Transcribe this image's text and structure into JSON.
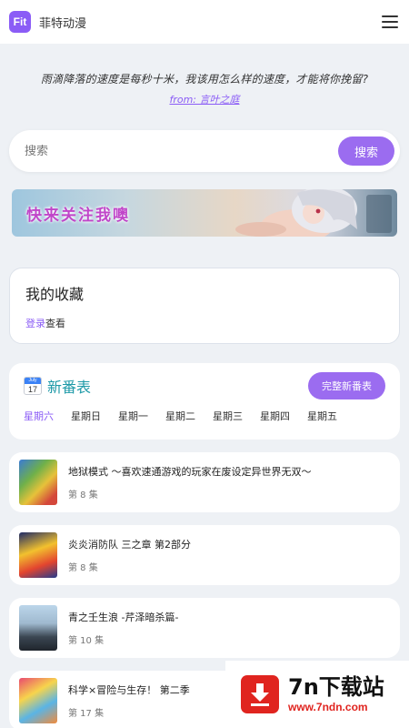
{
  "header": {
    "logo_text": "Fit",
    "title": "菲特动漫",
    "menu_icon": "hamburger-icon"
  },
  "quote": {
    "text": "雨滴降落的速度是每秒十米，我该用怎么样的速度，才能将你挽留?",
    "source": "from: 言叶之庭"
  },
  "search": {
    "placeholder": "搜索",
    "button": "搜索"
  },
  "banner": {
    "text": "快来关注我噢"
  },
  "favorites": {
    "title": "我的收藏",
    "login_link": "登录",
    "login_suffix": "查看"
  },
  "schedule": {
    "calendar_month": "July",
    "calendar_day": "17",
    "title": "新番表",
    "full_button": "完整新番表",
    "days": [
      "星期六",
      "星期日",
      "星期一",
      "星期二",
      "星期三",
      "星期四",
      "星期五"
    ],
    "active_day": "星期六"
  },
  "anime_list": [
    {
      "title": "地狱模式 ～喜欢速通游戏的玩家在废设定异世界无双～",
      "episode": "第 8 集"
    },
    {
      "title": "炎炎消防队 三之章 第2部分",
      "episode": "第 8 集"
    },
    {
      "title": "青之壬生浪 -芹泽暗杀篇-",
      "episode": "第 10 集"
    },
    {
      "title": "科学×冒险与生存！ 第二季",
      "episode": "第 17 集"
    }
  ],
  "watermark": {
    "title": "7n下载站",
    "url": "www.7ndn.com"
  },
  "colors": {
    "accent": "#9b6cf0",
    "schedule_title": "#1f9aa8",
    "background": "#eef1f5",
    "watermark_red": "#e0241f"
  }
}
